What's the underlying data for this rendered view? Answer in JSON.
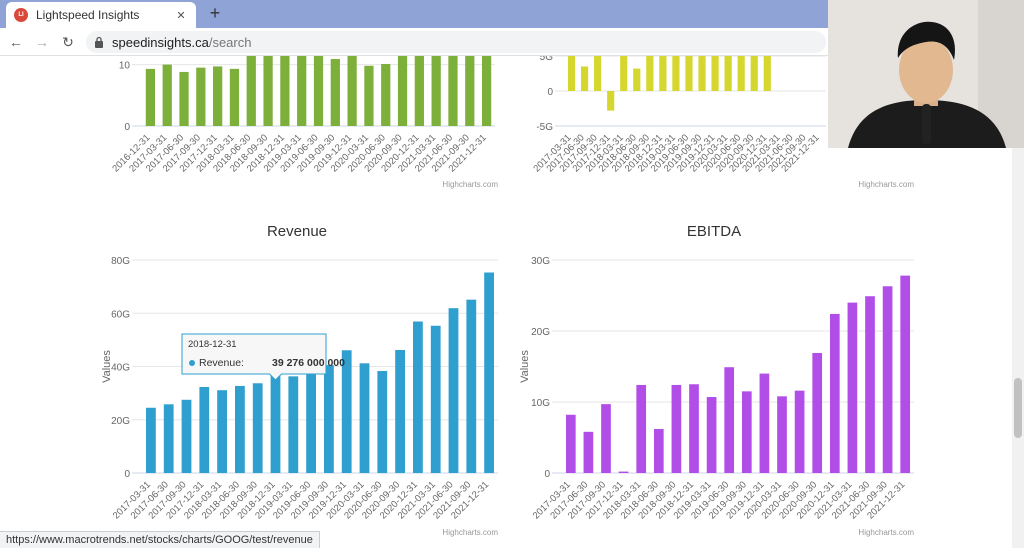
{
  "browser": {
    "tab_title": "Lightspeed Insights",
    "favicon_text": "LI",
    "url_host": "speedinsights.ca",
    "url_path": "/search",
    "status_url": "https://www.macrotrends.net/stocks/charts/GOOG/test/revenue"
  },
  "credits": "Highcharts.com",
  "chart_data": [
    {
      "type": "bar",
      "title": "",
      "ylabel": "",
      "color": "#7cb03b",
      "yticks": [
        "0",
        "10"
      ],
      "ylim": [
        0,
        14
      ],
      "categories": [
        "2016-12-31",
        "2017-03-31",
        "2017-06-30",
        "2017-09-30",
        "2017-12-31",
        "2018-03-31",
        "2018-06-30",
        "2018-09-30",
        "2018-12-31",
        "2019-03-31",
        "2019-06-30",
        "2019-09-30",
        "2019-12-31",
        "2020-03-31",
        "2020-06-30",
        "2020-09-30",
        "2020-12-31",
        "2021-03-31",
        "2021-06-30",
        "2021-09-30",
        "2021-12-31"
      ],
      "values": [
        9.3,
        10,
        8.8,
        9.5,
        9.7,
        9.3,
        11.6,
        13,
        12.7,
        11.8,
        13.4,
        10.9,
        13.5,
        9.8,
        10.1,
        13.4,
        13.4,
        13.4,
        13.4,
        13.4,
        13.4
      ]
    },
    {
      "type": "bar",
      "title": "",
      "ylabel": "",
      "color": "#d6d72e",
      "yticks": [
        "5G",
        "0",
        "-5G"
      ],
      "ylim": [
        -5,
        5
      ],
      "categories": [
        "2017-03-31",
        "2017-06-30",
        "2017-09-30",
        "2017-12-31",
        "2018-03-31",
        "2018-06-30",
        "2018-09-30",
        "2018-12-31",
        "2019-03-31",
        "2019-06-30",
        "2019-09-30",
        "2019-12-31",
        "2020-03-31",
        "2020-06-30",
        "2020-09-30",
        "2020-12-31",
        "2021-03-31",
        "2021-06-30",
        "2021-09-30",
        "2021-12-31"
      ],
      "values": [
        5,
        3.5,
        5,
        -2.8,
        5,
        3.2,
        5,
        5,
        5,
        5,
        5,
        5,
        5,
        5,
        5,
        5
      ]
    },
    {
      "type": "bar",
      "title": "Revenue",
      "ylabel": "Values",
      "color": "#2e9fcf",
      "yticks": [
        "0",
        "20G",
        "40G",
        "60G",
        "80G"
      ],
      "ylim": [
        0,
        80
      ],
      "categories": [
        "2017-03-31",
        "2017-06-30",
        "2017-09-30",
        "2017-12-31",
        "2018-03-31",
        "2018-06-30",
        "2018-09-30",
        "2018-12-31",
        "2019-03-31",
        "2019-06-30",
        "2019-09-30",
        "2019-12-31",
        "2020-03-31",
        "2020-06-30",
        "2020-09-30",
        "2020-12-31",
        "2021-03-31",
        "2021-06-30",
        "2021-09-30",
        "2021-12-31"
      ],
      "values": [
        24.5,
        25.8,
        27.5,
        32.3,
        31.1,
        32.7,
        33.7,
        39.3,
        36.3,
        38.9,
        40.5,
        46.1,
        41.2,
        38.3,
        46.2,
        56.9,
        55.3,
        61.9,
        65.1,
        75.3
      ],
      "tooltip": {
        "date": "2018-12-31",
        "label": "Revenue: ",
        "value": "39 276 000 000",
        "index": 7
      }
    },
    {
      "type": "bar",
      "title": "EBITDA",
      "ylabel": "Values",
      "color": "#b24ee8",
      "yticks": [
        "0",
        "10G",
        "20G",
        "30G"
      ],
      "ylim": [
        0,
        30
      ],
      "categories": [
        "2017-03-31",
        "2017-06-30",
        "2017-09-30",
        "2017-12-31",
        "2018-03-31",
        "2018-06-30",
        "2018-09-30",
        "2018-12-31",
        "2019-03-31",
        "2019-06-30",
        "2019-09-30",
        "2019-12-31",
        "2020-03-31",
        "2020-06-30",
        "2020-09-30",
        "2020-12-31",
        "2021-03-31",
        "2021-06-30",
        "2021-09-30",
        "2021-12-31"
      ],
      "values": [
        8.2,
        5.8,
        9.7,
        0.2,
        12.4,
        6.2,
        12.4,
        12.5,
        10.7,
        14.9,
        11.5,
        14,
        10.8,
        11.6,
        16.9,
        22.4,
        24,
        24.9,
        26.3,
        27.8
      ]
    }
  ]
}
